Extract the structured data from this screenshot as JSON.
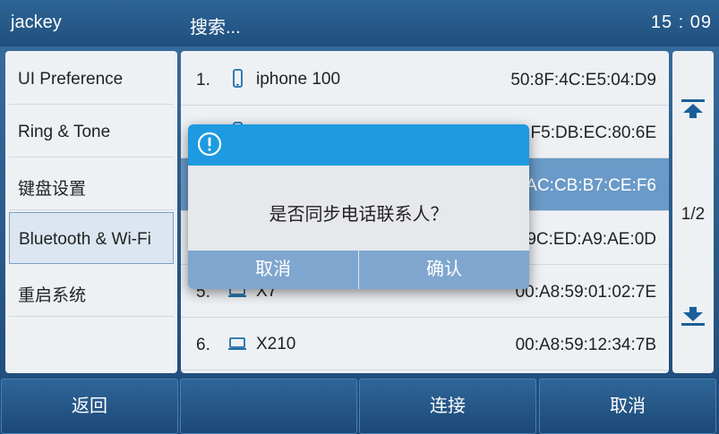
{
  "titlebar": {
    "user": "jackey",
    "title": "搜索...",
    "time": "15 : 09"
  },
  "menu": {
    "items": [
      {
        "label": "UI Preference"
      },
      {
        "label": "Ring & Tone"
      },
      {
        "label": "键盘设置"
      },
      {
        "label": "Bluetooth & Wi-Fi"
      },
      {
        "label": "重启系统"
      }
    ]
  },
  "devices": [
    {
      "num": "1.",
      "icon": "phone-icon",
      "name": "iphone 100",
      "mac": "50:8F:4C:E5:04:D9"
    },
    {
      "num": "",
      "icon": "phone-icon",
      "name": "",
      "mac": "F5:DB:EC:80:6E"
    },
    {
      "num": "",
      "icon": "",
      "name": "",
      "mac": "AC:CB:B7:CE:F6"
    },
    {
      "num": "",
      "icon": "",
      "name": "",
      "mac": "9C:ED:A9:AE:0D"
    },
    {
      "num": "5.",
      "icon": "laptop-icon",
      "name": "X7",
      "mac": "00:A8:59:01:02:7E"
    },
    {
      "num": "6.",
      "icon": "laptop-icon",
      "name": "X210",
      "mac": "00:A8:59:12:34:7B"
    }
  ],
  "pager": {
    "page": "1/2"
  },
  "softkeys": {
    "back": "返回",
    "empty": "",
    "connect": "连接",
    "cancel": "取消"
  },
  "dialog": {
    "message": "是否同步电话联系人？",
    "cancel": "取消",
    "confirm": "确认"
  },
  "colors": {
    "accent": "#1d9ae0",
    "selected_row": "#6a9ac8",
    "dialog_button": "#7fa6cf",
    "titlebar": "#2e6596"
  }
}
